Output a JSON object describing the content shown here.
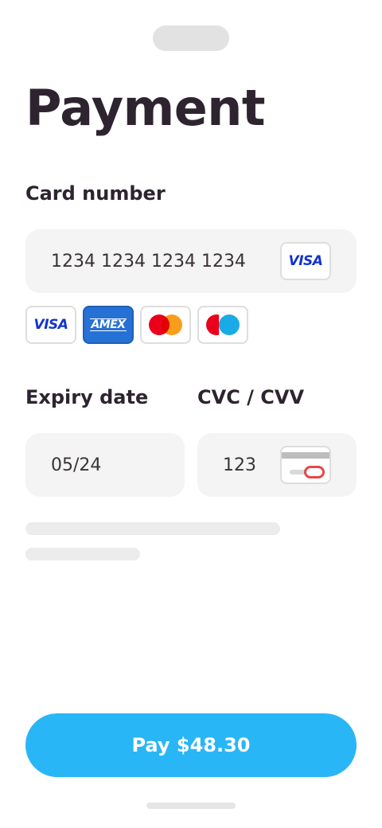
{
  "page": {
    "title": "Payment"
  },
  "card": {
    "label": "Card number",
    "value": "1234 1234 1234 1234",
    "detected_brand": "VISA"
  },
  "brands": [
    {
      "name": "VISA",
      "icon": "visa-logo"
    },
    {
      "name": "AMEX",
      "icon": "amex-logo"
    },
    {
      "name": "Mastercard",
      "icon": "mastercard-logo"
    },
    {
      "name": "Maestro",
      "icon": "maestro-logo"
    }
  ],
  "expiry": {
    "label": "Expiry date",
    "value": "05/24"
  },
  "cvc": {
    "label": "CVC / CVV",
    "value": "123",
    "icon": "card-back-cvc-icon"
  },
  "pay_button": {
    "label": "Pay $48.30"
  },
  "colors": {
    "accent": "#29b6f6",
    "text": "#2e2430",
    "field_bg": "#f4f4f4",
    "visa": "#1434cb",
    "amex": "#2671d6",
    "mastercard_red": "#eb001b",
    "mastercard_orange": "#f79e1b",
    "maestro_blue": "#00a2e5",
    "cvc_ring": "#e54848"
  }
}
